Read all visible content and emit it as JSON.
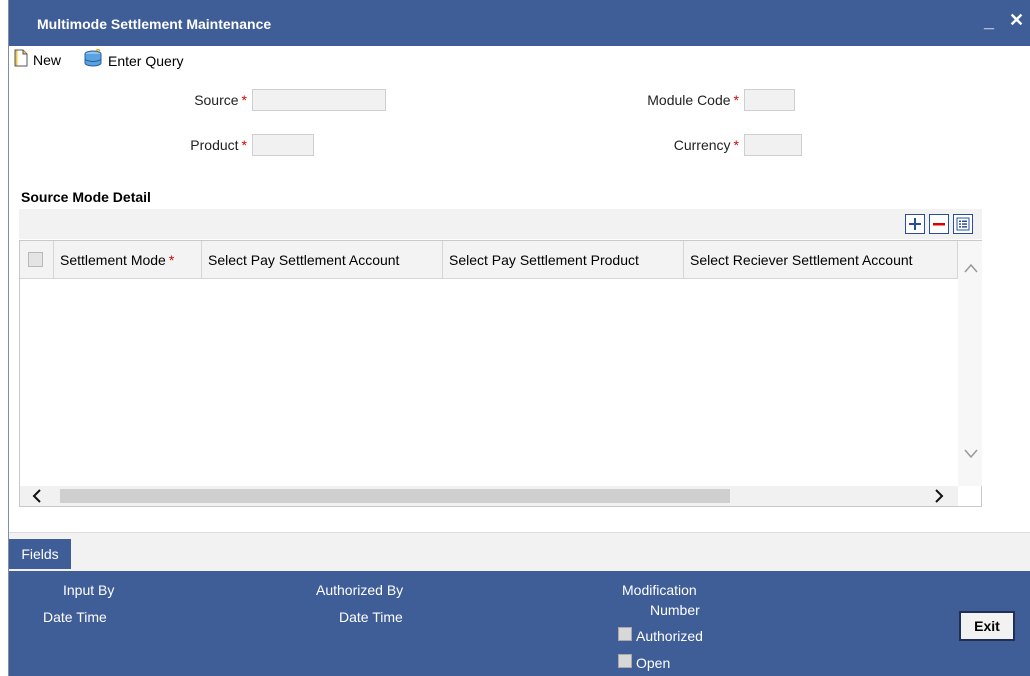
{
  "window": {
    "title": "Multimode Settlement Maintenance",
    "minimize_glyph": "_",
    "close_glyph": "✕"
  },
  "toolbar": {
    "new_label": "New",
    "enter_query_label": "Enter Query",
    "new_icon": "document-icon",
    "query_icon": "database-query-icon"
  },
  "form": {
    "source_label": "Source",
    "source_value": "",
    "product_label": "Product",
    "product_value": "",
    "module_code_label": "Module Code",
    "module_code_value": "",
    "currency_label": "Currency",
    "currency_value": "",
    "required_mark": "*"
  },
  "section": {
    "title": "Source Mode Detail"
  },
  "grid": {
    "buttons": [
      "add-row",
      "delete-row",
      "single-record-view"
    ],
    "columns": [
      {
        "label": "Settlement Mode",
        "required": true
      },
      {
        "label": "Select Pay Settlement Account",
        "required": false
      },
      {
        "label": "Select Pay Settlement Product",
        "required": false
      },
      {
        "label": "Select Reciever Settlement Account",
        "required": false
      }
    ],
    "rows": []
  },
  "fields_tab": {
    "label": "Fields"
  },
  "footer": {
    "input_by": "Input By",
    "date_time_1": "Date Time",
    "authorized_by": "Authorized By",
    "date_time_2": "Date Time",
    "modification": "Modification",
    "number": "Number",
    "authorized": "Authorized",
    "open": "Open",
    "exit_label": "Exit"
  },
  "colors": {
    "title_bar": "#3f5d97",
    "footer": "#3f5d97",
    "required": "#dd0000",
    "grid_button_border": "#2a4f9a"
  }
}
